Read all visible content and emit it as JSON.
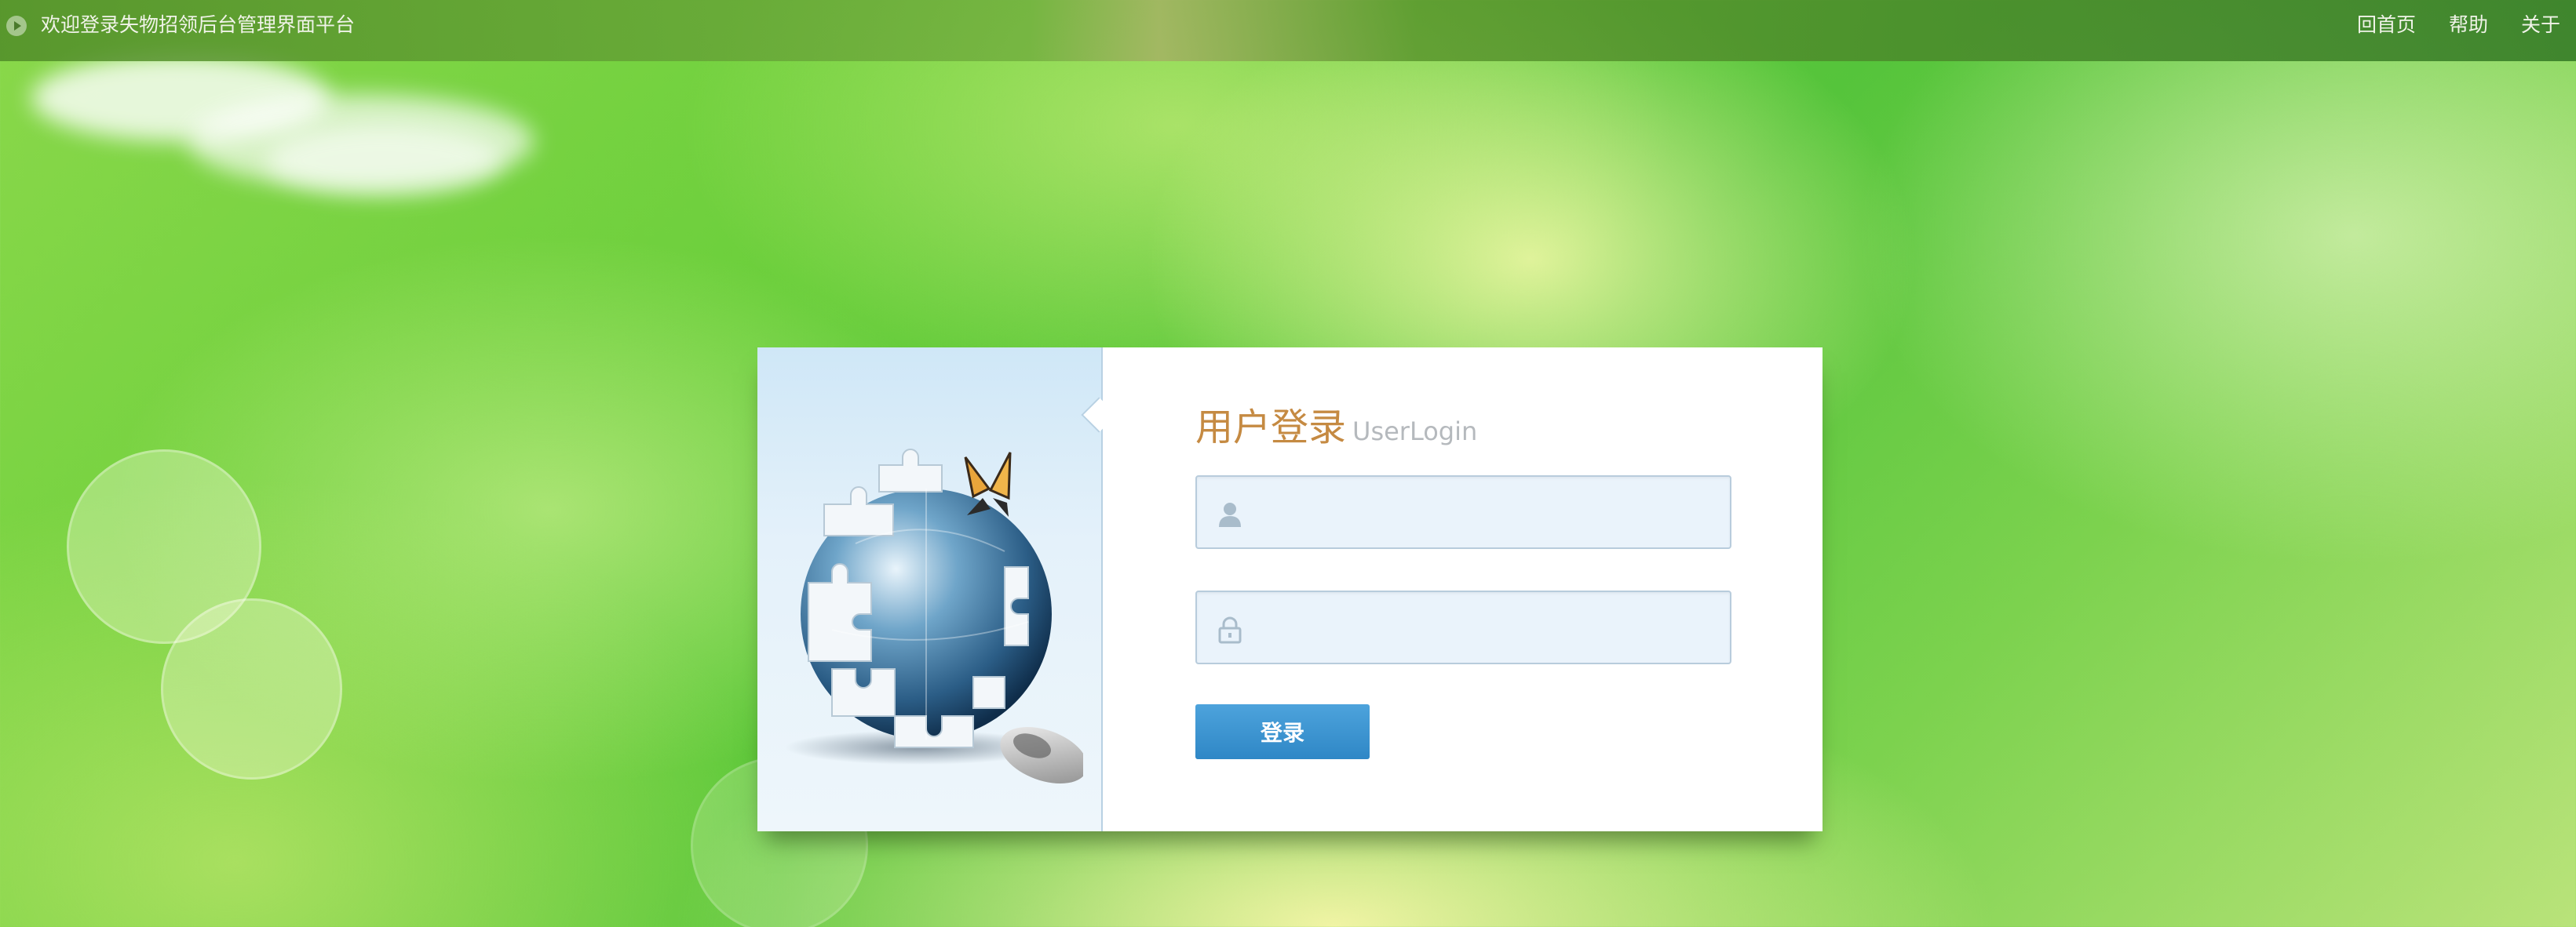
{
  "topbar": {
    "welcome_text": "欢迎登录失物招领后台管理界面平台",
    "nav": [
      {
        "label": "回首页"
      },
      {
        "label": "帮助"
      },
      {
        "label": "关于"
      }
    ]
  },
  "login": {
    "title_cn": "用户登录",
    "title_en": "UserLogin",
    "username_value": "",
    "password_value": "",
    "submit_label": "登录"
  },
  "icons": {
    "play": "play-circle-icon",
    "user": "user-icon",
    "lock": "lock-icon",
    "globe": "puzzle-globe-illustration"
  },
  "colors": {
    "title_accent": "#c58a42",
    "button": "#3b93d1",
    "field_bg": "#eaf3fb"
  }
}
